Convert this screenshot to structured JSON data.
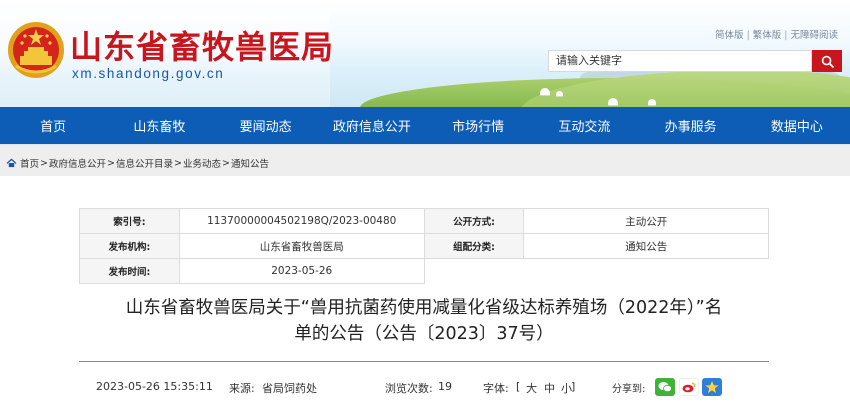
{
  "header": {
    "site_title": "山东省畜牧兽医局",
    "site_domain": "xm.shandong.gov.cn",
    "top_links": [
      "简体版",
      "繁体版",
      "无障碍阅读"
    ],
    "search_placeholder": "请输入关键字"
  },
  "nav": {
    "items": [
      "首页",
      "山东畜牧",
      "要闻动态",
      "政府信息公开",
      "市场行情",
      "互动交流",
      "办事服务",
      "数据中心"
    ]
  },
  "breadcrumb": {
    "items": [
      "首页",
      "政府信息公开",
      "信息公开目录",
      "业务动态",
      "通知公告"
    ],
    "separator": ">"
  },
  "info": {
    "index_label": "索引号:",
    "index_value": "11370000004502198Q/2023-00480",
    "disclosure_label": "公开方式:",
    "disclosure_value": "主动公开",
    "publisher_label": "发布机构:",
    "publisher_value": "山东省畜牧兽医局",
    "category_label": "组配分类:",
    "category_value": "通知公告",
    "date_label": "发布时间:",
    "date_value": "2023-05-26"
  },
  "article": {
    "title_line1": "山东省畜牧兽医局关于“兽用抗菌药使用减量化省级达标养殖场（2022年）”名",
    "title_line2": "单的公告（公告〔2023〕37号）",
    "datetime": "2023-05-26 15:35:11",
    "source_label": "来源:",
    "source_value": "省局饲药处",
    "views_label": "浏览次数:",
    "views_value": "19",
    "font_label": "字体:",
    "font_open": "[",
    "font_large": "大",
    "font_medium": "中",
    "font_small": "小",
    "font_close": "]",
    "share_label": "分享到:"
  },
  "colors": {
    "brand_red": "#c8161d",
    "nav_blue": "#0d5cb6",
    "domain_blue": "#1a56a8"
  },
  "icons": [
    "national-emblem",
    "search-icon",
    "home-icon",
    "wechat-icon",
    "weibo-icon",
    "qzone-icon"
  ]
}
